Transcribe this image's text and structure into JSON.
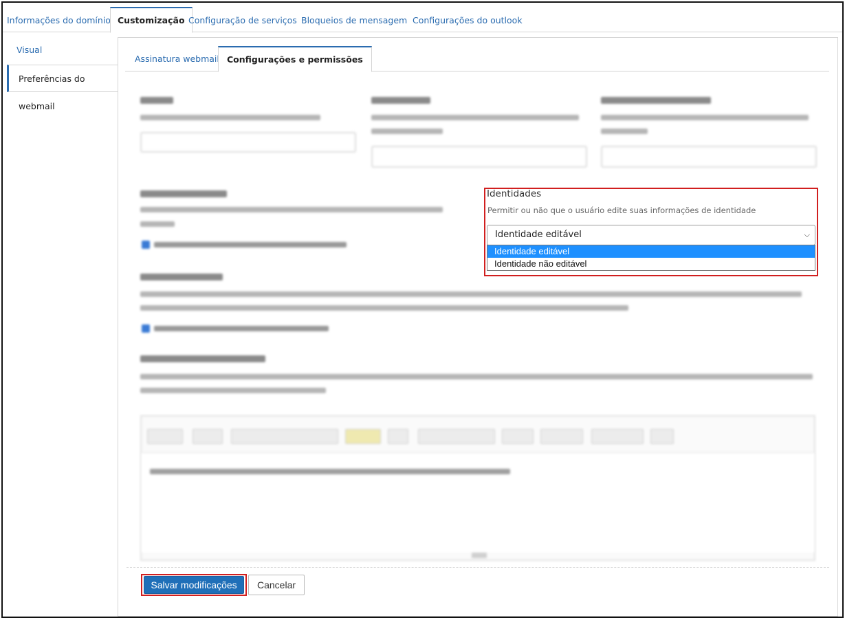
{
  "top_tabs": [
    {
      "label": "Informações do domínio"
    },
    {
      "label": "Customização"
    },
    {
      "label": "Configuração de serviços"
    },
    {
      "label": "Bloqueios de mensagem"
    },
    {
      "label": "Configurações do outlook"
    }
  ],
  "sidebar": {
    "items": [
      {
        "label": "Visual"
      },
      {
        "label": "Preferências do webmail"
      }
    ]
  },
  "sub_tabs": [
    {
      "label": "Assinatura webmail"
    },
    {
      "label": "Configurações e permissões"
    }
  ],
  "identities": {
    "title": "Identidades",
    "description": "Permitir ou não que o usuário edite suas informações de identidade",
    "selected": "Identidade editável",
    "options": [
      "Identidade editável",
      "Identidade não editável"
    ]
  },
  "actions": {
    "save": "Salvar modificações",
    "cancel": "Cancelar"
  },
  "colors": {
    "accent": "#2b6cb0",
    "highlight": "#d11f1f",
    "save_button": "#1f6fb8",
    "option_selected": "#1e90ff"
  }
}
